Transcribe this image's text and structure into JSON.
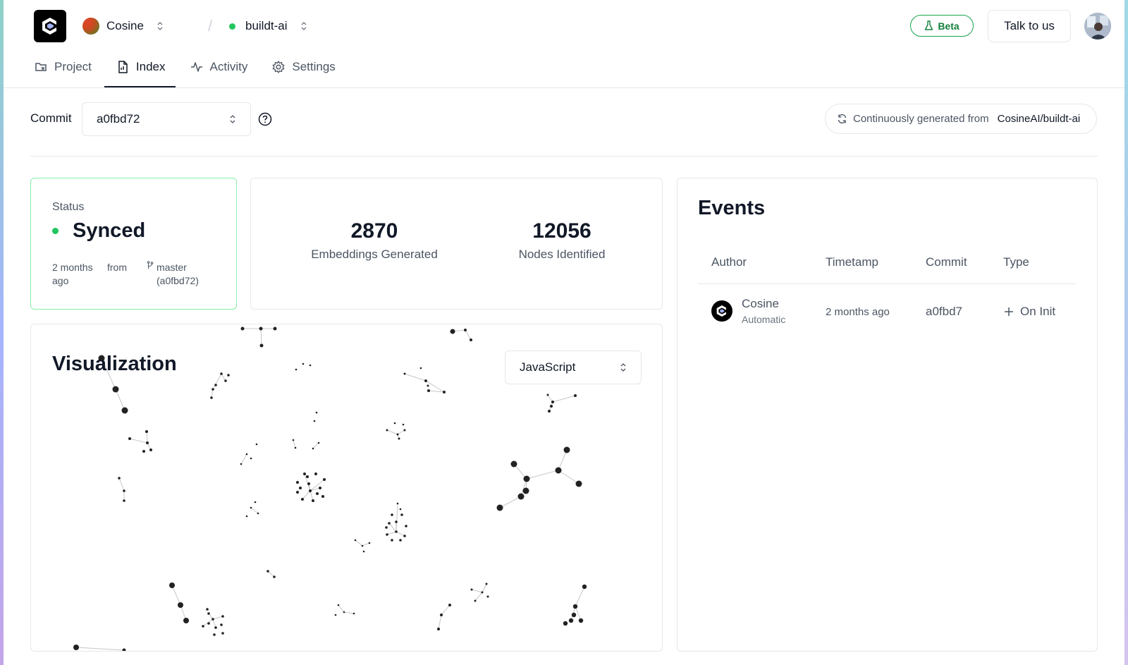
{
  "header": {
    "org_name": "Cosine",
    "project_name": "buildt-ai",
    "beta_label": "Beta",
    "talk_label": "Talk to us"
  },
  "tabs": [
    {
      "label": "Project",
      "icon": "project-icon"
    },
    {
      "label": "Index",
      "icon": "file-index-icon",
      "active": true
    },
    {
      "label": "Activity",
      "icon": "activity-icon"
    },
    {
      "label": "Settings",
      "icon": "gear-icon"
    }
  ],
  "commit_bar": {
    "label": "Commit",
    "selected": "a0fbd72",
    "continuous_text": "Continuously generated from",
    "repo": "CosineAI/buildt-ai"
  },
  "status": {
    "label": "Status",
    "value": "Synced",
    "time_line1": "2 months",
    "time_line2": "ago",
    "from_label": "from",
    "branch": "master",
    "branch_commit": "(a0fbd72)"
  },
  "stats": {
    "embeddings": {
      "value": "2870",
      "label": "Embeddings Generated"
    },
    "nodes": {
      "value": "12056",
      "label": "Nodes Identified"
    }
  },
  "visualization": {
    "title": "Visualization",
    "language": "JavaScript"
  },
  "events": {
    "title": "Events",
    "columns": [
      "Author",
      "Timetamp",
      "Commit",
      "Type"
    ],
    "rows": [
      {
        "author": "Cosine",
        "sub": "Automatic",
        "time": "2 months ago",
        "commit": "a0fbd7",
        "type": "On Init"
      }
    ]
  },
  "colors": {
    "accent_green": "#22c55e",
    "beta_green": "#15803d",
    "border": "#e5e7eb"
  }
}
